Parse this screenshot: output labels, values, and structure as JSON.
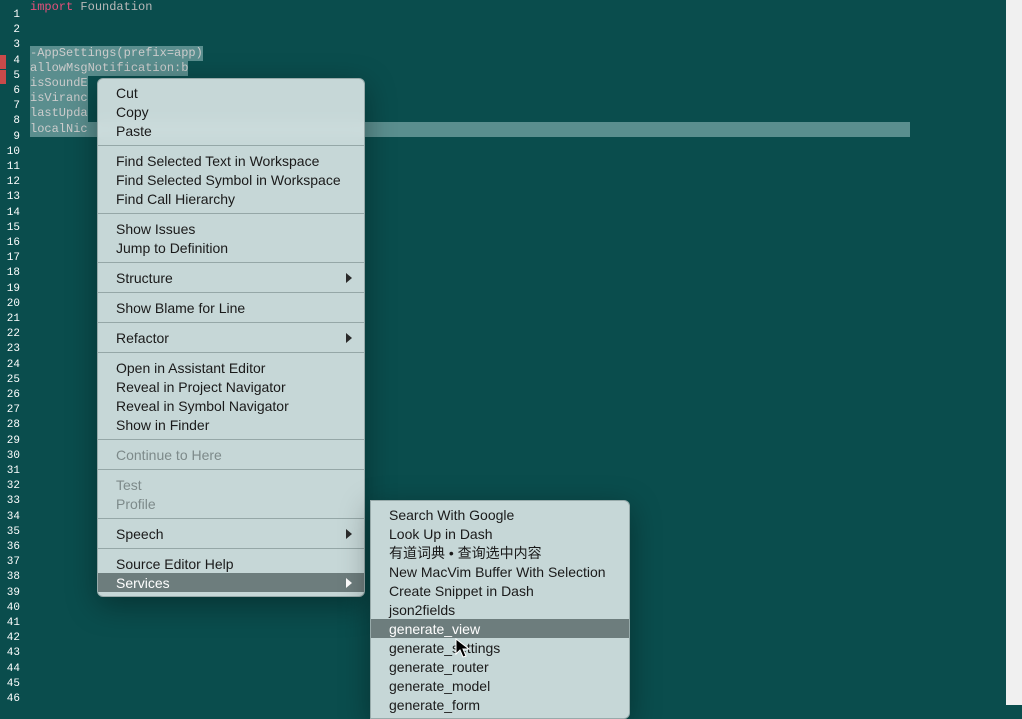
{
  "gutter": {
    "start": 1,
    "end": 46,
    "breakpoints": [
      4,
      5
    ]
  },
  "code": {
    "line1_kw": "import",
    "line1_rest": " Foundation",
    "line4": "-AppSettings(prefix=app)",
    "line5": "allowMsgNotification:b",
    "line6": "isSoundE",
    "line7": "isViranc",
    "line8": "lastUpda",
    "line9": "localNic"
  },
  "menu": {
    "cut": "Cut",
    "copy": "Copy",
    "paste": "Paste",
    "find_text": "Find Selected Text in Workspace",
    "find_symbol": "Find Selected Symbol in Workspace",
    "find_call": "Find Call Hierarchy",
    "show_issues": "Show Issues",
    "jump_def": "Jump to Definition",
    "structure": "Structure",
    "show_blame": "Show Blame for Line",
    "refactor": "Refactor",
    "open_assistant": "Open in Assistant Editor",
    "reveal_proj": "Reveal in Project Navigator",
    "reveal_sym": "Reveal in Symbol Navigator",
    "show_finder": "Show in Finder",
    "continue_here": "Continue to Here",
    "test": "Test",
    "profile": "Profile",
    "speech": "Speech",
    "editor_help": "Source Editor Help",
    "services": "Services"
  },
  "submenu": {
    "search_google": "Search With Google",
    "lookup_dash": "Look Up in Dash",
    "youdao": "有道词典 • 查询选中内容",
    "macvim": "New MacVim Buffer With Selection",
    "snippet_dash": "Create Snippet in Dash",
    "json2fields": "json2fields",
    "gen_view": "generate_view",
    "gen_settings": "generate_settings",
    "gen_router": "generate_router",
    "gen_model": "generate_model",
    "gen_form": "generate_form"
  }
}
